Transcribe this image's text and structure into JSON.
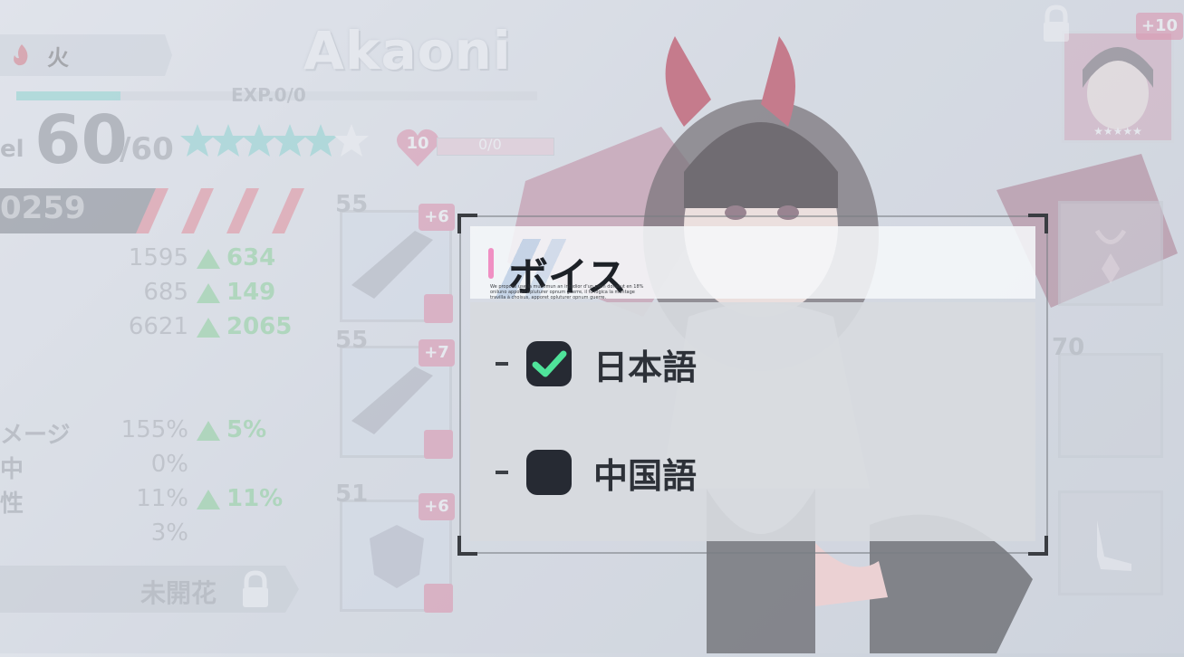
{
  "character": {
    "element_label": "火",
    "name": "Akaoni",
    "exp_label": "EXP.0/0",
    "exp_progress": 0.2,
    "level_prefix": "el",
    "level": "60",
    "level_max": "/60",
    "stars_filled": 5,
    "stars_total": 6,
    "bond_level": "10",
    "bond_value": "0/0",
    "power_value": "0259"
  },
  "stats": [
    {
      "label": "",
      "value": "1595",
      "bonus": "634"
    },
    {
      "label": "",
      "value": "685",
      "bonus": "149"
    },
    {
      "label": "",
      "value": "6621",
      "bonus": "2065"
    },
    {
      "label": "メージ",
      "value": "155%",
      "bonus": "5%"
    },
    {
      "label": "中",
      "value": "0%",
      "bonus": ""
    },
    {
      "label": "性",
      "value": "11%",
      "bonus": "11%"
    },
    {
      "label": "",
      "value": "3%",
      "bonus": ""
    }
  ],
  "unbloom_label": "未開花",
  "equipment": [
    {
      "level": "55",
      "plus": "+6"
    },
    {
      "level": "55",
      "plus": "+7"
    },
    {
      "level": "51",
      "plus": "+6"
    }
  ],
  "portrait_plus": "+10",
  "right_slot_level": "70",
  "dialog": {
    "title": "ボイス",
    "subtitle": "We propose use la mustimun an intudior d'un plein donatut en 18% oniluno apporet opluturer opnum guerre, il fo logica la montage travilla à choisus, apporet opluturer opnum guerre.",
    "options": [
      {
        "label": "日本語",
        "checked": true
      },
      {
        "label": "中国語",
        "checked": false
      }
    ]
  },
  "colors": {
    "accent_pink": "#d75f86",
    "check_green": "#4fe39a",
    "teal": "#5cc9c0",
    "bonus_green": "#5bc46e"
  }
}
